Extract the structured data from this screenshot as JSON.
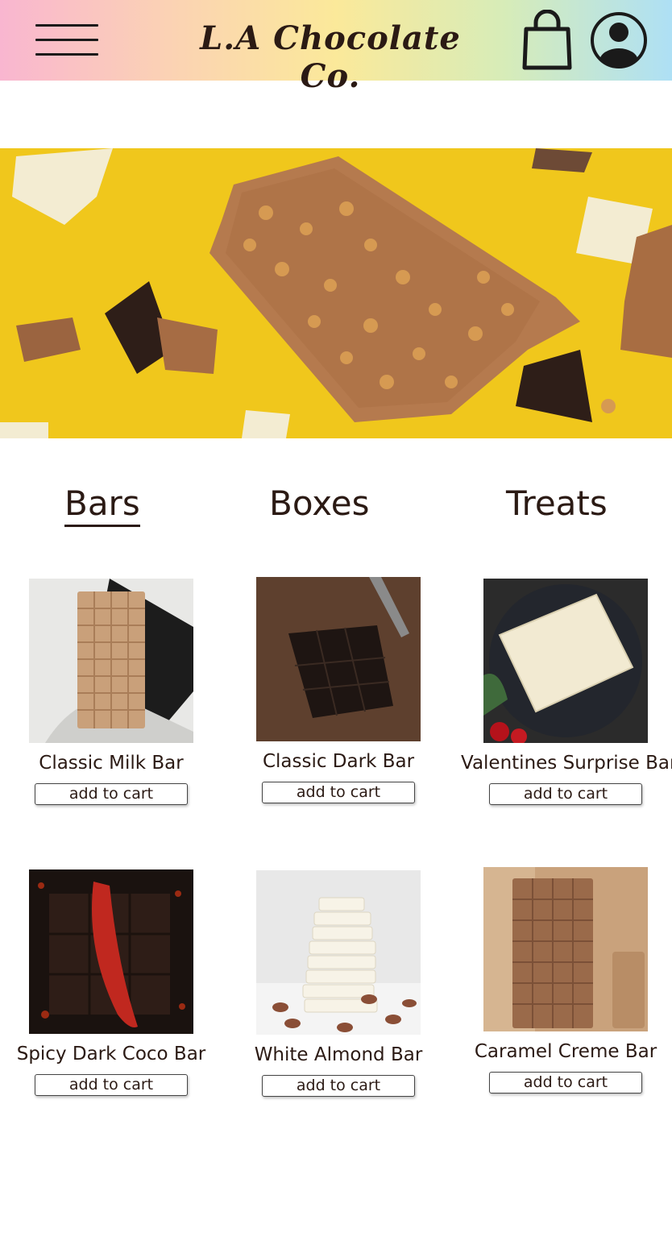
{
  "header": {
    "brand": "L.A Chocolate Co.",
    "menu_icon": "hamburger-menu-icon",
    "cart_icon": "shopping-bag-icon",
    "account_icon": "user-avatar-icon"
  },
  "tabs": [
    {
      "label": "Bars",
      "active": true
    },
    {
      "label": "Boxes",
      "active": false
    },
    {
      "label": "Treats",
      "active": false
    }
  ],
  "products": [
    {
      "name": "Classic Milk Bar",
      "button": "add to cart"
    },
    {
      "name": "Classic Dark Bar",
      "button": "add to cart"
    },
    {
      "name": "Valentines Surprise Bar",
      "button": "add to cart"
    },
    {
      "name": "Spicy Dark Coco Bar",
      "button": "add to cart"
    },
    {
      "name": "White Almond Bar",
      "button": "add to cart"
    },
    {
      "name": "Caramel Creme Bar",
      "button": "add to cart"
    }
  ],
  "colors": {
    "text": "#2b1a14",
    "hero_bg": "#f0c71c",
    "milk_chocolate": "#b07a4e",
    "dark_chocolate": "#2e1e18",
    "white_chocolate": "#f3ecd2"
  }
}
